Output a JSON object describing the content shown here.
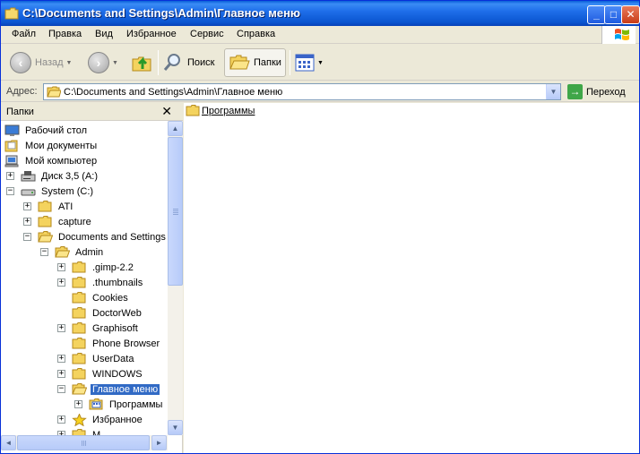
{
  "window": {
    "title": "C:\\Documents and Settings\\Admin\\Главное меню",
    "buttons": {
      "minimize": "_",
      "maximize": "□",
      "close": "✕"
    }
  },
  "menubar": {
    "items": [
      {
        "label": "Файл"
      },
      {
        "label": "Правка"
      },
      {
        "label": "Вид"
      },
      {
        "label": "Избранное"
      },
      {
        "label": "Сервис"
      },
      {
        "label": "Справка"
      }
    ]
  },
  "toolbar": {
    "back_label": "Назад",
    "search_label": "Поиск",
    "folders_label": "Папки"
  },
  "address": {
    "label": "Адрес:",
    "value": "C:\\Documents and Settings\\Admin\\Главное меню",
    "go_label": "Переход"
  },
  "folders_pane": {
    "title": "Папки",
    "close": "✕",
    "tree": [
      {
        "label": "Рабочий стол",
        "level": 0,
        "expander": "none",
        "icon": "desktop-icon"
      },
      {
        "label": "Мои документы",
        "level": 0,
        "expander": "none",
        "icon": "my-documents-icon"
      },
      {
        "label": "Мой компьютер",
        "level": 0,
        "expander": "none",
        "icon": "my-computer-icon"
      },
      {
        "label": "Диск 3,5 (A:)",
        "level": 1,
        "expander": "+",
        "icon": "floppy-drive-icon"
      },
      {
        "label": "System (C:)",
        "level": 1,
        "expander": "-",
        "icon": "hard-drive-icon"
      },
      {
        "label": "ATI",
        "level": 2,
        "expander": "+",
        "icon": "folder-icon"
      },
      {
        "label": "capture",
        "level": 2,
        "expander": "+",
        "icon": "folder-icon"
      },
      {
        "label": "Documents and Settings",
        "level": 2,
        "expander": "-",
        "icon": "folder-open-icon"
      },
      {
        "label": "Admin",
        "level": 3,
        "expander": "-",
        "icon": "folder-open-icon"
      },
      {
        "label": ".gimp-2.2",
        "level": 4,
        "expander": "+",
        "icon": "folder-icon"
      },
      {
        "label": ".thumbnails",
        "level": 4,
        "expander": "+",
        "icon": "folder-icon"
      },
      {
        "label": "Cookies",
        "level": 4,
        "expander": "none",
        "icon": "folder-icon"
      },
      {
        "label": "DoctorWeb",
        "level": 4,
        "expander": "none",
        "icon": "folder-icon"
      },
      {
        "label": "Graphisoft",
        "level": 4,
        "expander": "+",
        "icon": "folder-icon"
      },
      {
        "label": "Phone Browser",
        "level": 4,
        "expander": "none",
        "icon": "folder-icon"
      },
      {
        "label": "UserData",
        "level": 4,
        "expander": "+",
        "icon": "folder-icon"
      },
      {
        "label": "WINDOWS",
        "level": 4,
        "expander": "+",
        "icon": "folder-icon"
      },
      {
        "label": "Главное меню",
        "level": 4,
        "expander": "-",
        "icon": "folder-open-icon",
        "selected": true
      },
      {
        "label": "Программы",
        "level": 5,
        "expander": "+",
        "icon": "programs-folder-icon"
      },
      {
        "label": "Избранное",
        "level": 4,
        "expander": "+",
        "icon": "favorites-icon"
      },
      {
        "label": "М...",
        "level": 4,
        "expander": "+",
        "icon": "folder-icon"
      }
    ]
  },
  "content": {
    "items": [
      {
        "label": "Программы",
        "icon": "folder-icon"
      }
    ]
  },
  "colors": {
    "selection": "#316ac5",
    "title_bar": "#0a55d0",
    "folder": "#f4d35e"
  }
}
